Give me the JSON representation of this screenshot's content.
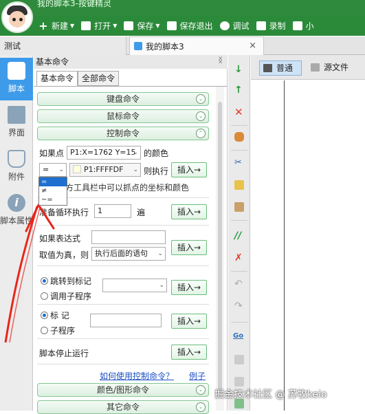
{
  "window": {
    "title": "我的脚本3-按键精灵"
  },
  "toolbar": {
    "items": [
      {
        "label": "新建",
        "icon": "plus-icon",
        "dropdown": true
      },
      {
        "label": "打开",
        "icon": "folder-icon",
        "dropdown": true
      },
      {
        "label": "保存",
        "icon": "save-icon",
        "dropdown": true
      },
      {
        "label": "保存退出",
        "icon": "save-exit-icon",
        "dropdown": false
      },
      {
        "label": "调试",
        "icon": "play-icon",
        "dropdown": false
      },
      {
        "label": "录制",
        "icon": "camera-icon",
        "dropdown": false
      },
      {
        "label": "小",
        "icon": "tools-icon",
        "dropdown": false
      }
    ]
  },
  "doc_tabs": [
    {
      "label": "测试",
      "active": false
    },
    {
      "label": "我的脚本3",
      "active": true,
      "close": "×"
    }
  ],
  "side_nav": [
    {
      "label": "脚本",
      "icon": "script-icon",
      "active": true
    },
    {
      "label": "界面",
      "icon": "layout-icon",
      "active": false
    },
    {
      "label": "附件",
      "icon": "attachment-icon",
      "active": false
    },
    {
      "label": "脚本属性",
      "icon": "info-icon",
      "active": false
    }
  ],
  "panel": {
    "title": "基本命令",
    "pin": "ᛝ",
    "tabs": [
      {
        "label": "基本命令"
      },
      {
        "label": "全部命令"
      }
    ],
    "sections": {
      "keyboard": "键盘命令",
      "mouse": "鼠标命令",
      "control": "控制命令",
      "color": "颜色/图形命令",
      "other": "其它命令"
    },
    "if_point": {
      "label": "如果点",
      "point_value": "P1:X=1762 Y=15",
      "color_label": "的颜色",
      "operator_value": "=",
      "color_value": "P1:FFFFDF",
      "then_label": "则执行",
      "hint": "方工具栏中可以抓点的坐标和颜色",
      "operator_options": [
        "=",
        "≠",
        "~="
      ]
    },
    "loop": {
      "prefix": "准备循环执行",
      "count": "1",
      "suffix": "遍"
    },
    "if_expr": {
      "label": "如果表达式",
      "value": "",
      "true_label": "取值为真，则",
      "action_value": "执行后面的语句"
    },
    "jump": {
      "option1": "跳转到标记",
      "option2": "调用子程序",
      "selected": "跳转到标记"
    },
    "mark": {
      "option1": "标 记",
      "option2": "子程序",
      "selected": "标 记",
      "value": ""
    },
    "stop": {
      "label": "脚本停止运行"
    },
    "insert_label": "插入→",
    "help_link": "如何使用控制命令？",
    "example_link": "例子"
  },
  "editor": {
    "tabs": [
      {
        "label": "普通",
        "active": true
      },
      {
        "label": "源文件",
        "active": false
      }
    ]
  },
  "watermark": "掘金技术社区 @ 苏牧keio",
  "colors": {
    "brand_green": "#2b8a39",
    "accent_blue": "#3d9be9",
    "annotation_red": "#e8251c"
  }
}
